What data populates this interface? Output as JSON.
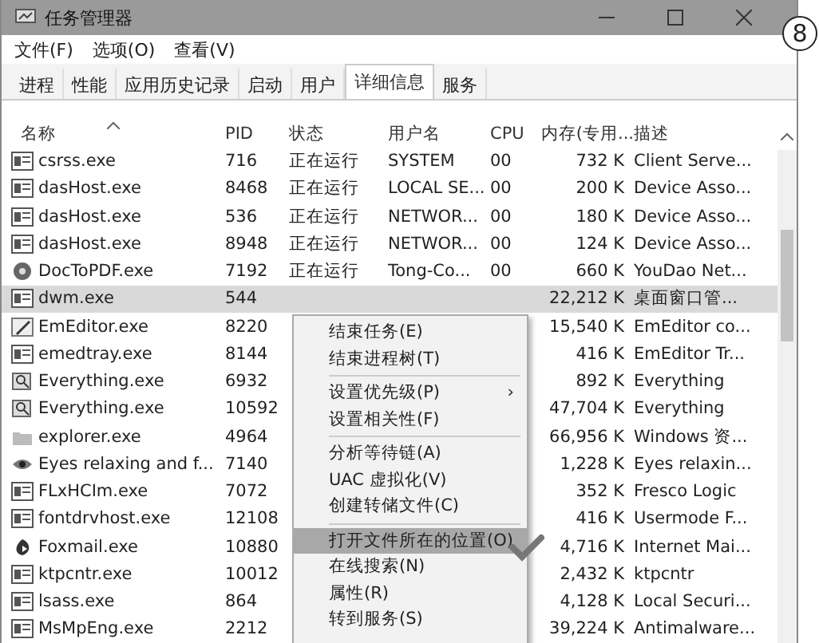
{
  "window": {
    "title": "任务管理器",
    "badge": "8"
  },
  "menu": [
    "文件(F)",
    "选项(O)",
    "查看(V)"
  ],
  "tabs": [
    {
      "label": "进程",
      "selected": false
    },
    {
      "label": "性能",
      "selected": false
    },
    {
      "label": "应用历史记录",
      "selected": false
    },
    {
      "label": "启动",
      "selected": false
    },
    {
      "label": "用户",
      "selected": false
    },
    {
      "label": "详细信息",
      "selected": true
    },
    {
      "label": "服务",
      "selected": false
    }
  ],
  "table": {
    "columns": [
      "名称",
      "PID",
      "状态",
      "用户名",
      "CPU",
      "内存(专用...",
      "描述"
    ],
    "rows": [
      {
        "kind": "app",
        "name": "csrss.exe",
        "pid": "716",
        "status": "正在运行",
        "user": "SYSTEM",
        "cpu": "00",
        "memory": "732 K",
        "description": "Client Serve...",
        "selected": false
      },
      {
        "kind": "app",
        "name": "dasHost.exe",
        "pid": "8468",
        "status": "正在运行",
        "user": "LOCAL SE...",
        "cpu": "00",
        "memory": "200 K",
        "description": "Device Asso...",
        "selected": false
      },
      {
        "kind": "app",
        "name": "dasHost.exe",
        "pid": "536",
        "status": "正在运行",
        "user": "NETWOR...",
        "cpu": "00",
        "memory": "180 K",
        "description": "Device Asso...",
        "selected": false
      },
      {
        "kind": "app",
        "name": "dasHost.exe",
        "pid": "8948",
        "status": "正在运行",
        "user": "NETWOR...",
        "cpu": "00",
        "memory": "124 K",
        "description": "Device Asso...",
        "selected": false
      },
      {
        "kind": "disc",
        "name": "DocToPDF.exe",
        "pid": "7192",
        "status": "正在运行",
        "user": "Tong-Co...",
        "cpu": "00",
        "memory": "660 K",
        "description": "YouDao Net...",
        "selected": false
      },
      {
        "kind": "app",
        "name": "dwm.exe",
        "pid": "544",
        "memory": "22,212 K",
        "description": "桌面窗口管...",
        "selected": true
      },
      {
        "kind": "editor",
        "name": "EmEditor.exe",
        "pid": "8220",
        "memory": "15,540 K",
        "description": "EmEditor co...",
        "selected": false
      },
      {
        "kind": "app",
        "name": "emedtray.exe",
        "pid": "8144",
        "memory": "416 K",
        "description": "EmEditor Tr...",
        "selected": false
      },
      {
        "kind": "search",
        "name": "Everything.exe",
        "pid": "6932",
        "memory": "892 K",
        "description": "Everything",
        "selected": false
      },
      {
        "kind": "search",
        "name": "Everything.exe",
        "pid": "10592",
        "memory": "47,704 K",
        "description": "Everything",
        "selected": false
      },
      {
        "kind": "folder",
        "name": "explorer.exe",
        "pid": "4964",
        "memory": "66,956 K",
        "description": "Windows 资...",
        "selected": false
      },
      {
        "kind": "eyes",
        "name": "Eyes relaxing and f...",
        "pid": "7140",
        "memory": "1,228 K",
        "description": "Eyes relaxin...",
        "selected": false
      },
      {
        "kind": "app",
        "name": "FLxHCIm.exe",
        "pid": "7072",
        "memory": "352 K",
        "description": "Fresco Logic",
        "selected": false
      },
      {
        "kind": "app",
        "name": "fontdrvhost.exe",
        "pid": "12108",
        "memory": "416 K",
        "description": "Usermode F...",
        "selected": false
      },
      {
        "kind": "mail",
        "name": "Foxmail.exe",
        "pid": "10880",
        "memory": "4,716 K",
        "description": "Internet Mai...",
        "selected": false
      },
      {
        "kind": "app",
        "name": "ktpcntr.exe",
        "pid": "10012",
        "memory": "2,432 K",
        "description": "ktpcntr",
        "selected": false
      },
      {
        "kind": "app",
        "name": "lsass.exe",
        "pid": "864",
        "memory": "4,128 K",
        "description": "Local Securi...",
        "selected": false
      },
      {
        "kind": "app",
        "name": "MsMpEng.exe",
        "pid": "2212",
        "memory": "39,224 K",
        "description": "Antimalware...",
        "selected": false
      }
    ]
  },
  "context_menu": [
    {
      "kind": "item",
      "label": "结束任务(E)",
      "selected": false
    },
    {
      "kind": "item",
      "label": "结束进程树(T)",
      "selected": false
    },
    {
      "kind": "separator"
    },
    {
      "kind": "submenu",
      "label": "设置优先级(P)",
      "arrow": "›",
      "selected": false
    },
    {
      "kind": "item",
      "label": "设置相关性(F)",
      "selected": false
    },
    {
      "kind": "separator"
    },
    {
      "kind": "item",
      "label": "分析等待链(A)",
      "selected": false
    },
    {
      "kind": "item",
      "label": "UAC 虚拟化(V)",
      "selected": false
    },
    {
      "kind": "item",
      "label": "创建转储文件(C)",
      "selected": false
    },
    {
      "kind": "separator"
    },
    {
      "kind": "item",
      "label": "打开文件所在的位置(O)",
      "selected": true
    },
    {
      "kind": "item",
      "label": "在线搜索(N)",
      "selected": false
    },
    {
      "kind": "item",
      "label": "属性(R)",
      "selected": false
    },
    {
      "kind": "item",
      "label": "转到服务(S)",
      "selected": false
    }
  ]
}
